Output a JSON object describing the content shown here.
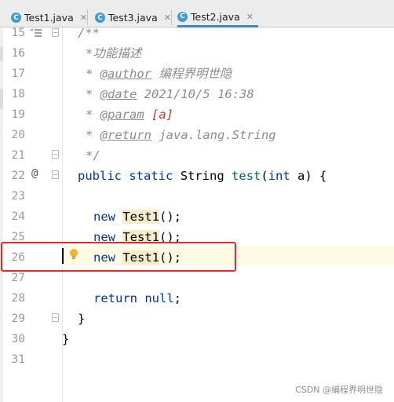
{
  "tabs": [
    {
      "label": "Test1.java",
      "icon": "java-class-icon",
      "active": false
    },
    {
      "label": "Test3.java",
      "icon": "java-class-icon",
      "active": false
    },
    {
      "label": "Test2.java",
      "icon": "java-class-icon",
      "active": true
    }
  ],
  "tab_icon_letter": "C",
  "tab_close_glyph": "✕",
  "gutter": {
    "line_numbers": [
      "15",
      "16",
      "17",
      "18",
      "19",
      "20",
      "21",
      "22",
      "23",
      "24",
      "25",
      "26",
      "27",
      "28",
      "29",
      "30",
      "31"
    ],
    "override_marker": "@"
  },
  "code": {
    "l15": "/**",
    "l16": "*功能描述",
    "l17_prefix": "* ",
    "l17_tag": "@author",
    "l17_value": " 编程界明世隐",
    "l18_prefix": "* ",
    "l18_tag": "@date",
    "l18_value": " 2021/10/5 16:38",
    "l19_prefix": "* ",
    "l19_tag": "@param",
    "l19_space": " ",
    "l19_value": "[a]",
    "l20_prefix": "* ",
    "l20_tag": "@return",
    "l20_value": " java.lang.String",
    "l21": "*/",
    "l22_kw1": "public",
    "l22_kw2": "static",
    "l22_type": "String",
    "l22_name": "test",
    "l22_open": "(",
    "l22_kw3": "int",
    "l22_param": "a",
    "l22_close": ") {",
    "new_kw": "new",
    "class_name": "Test1",
    "call_suffix": "();",
    "return_kw": "return",
    "null_kw": "null",
    "semicolon": ";",
    "close_brace": "}"
  },
  "colors": {
    "keyword": "#0033b3",
    "doc_comment": "#8c8c8c",
    "param_value": "#c4392f",
    "method_name": "#00627a",
    "highlight_border": "#e8262b",
    "caret_line": "#fffae3"
  },
  "watermark": "CSDN @编程界明世隐"
}
